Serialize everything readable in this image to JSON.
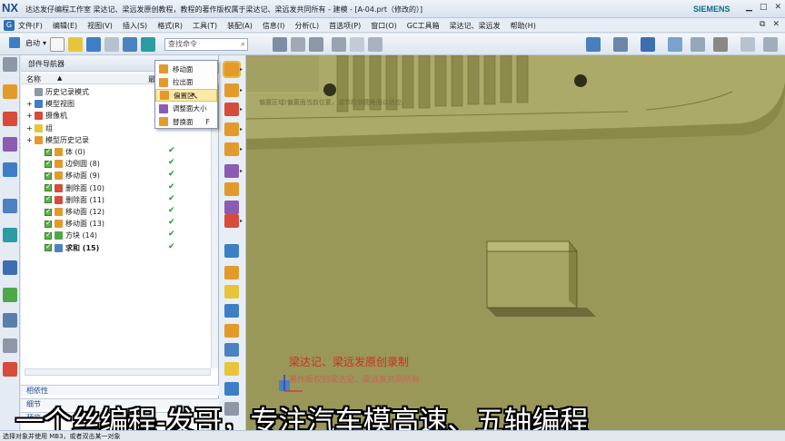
{
  "app": {
    "logo": "NX",
    "title": "达达发仔编程工作室  梁达记、梁远发原创教程，教程的著作版权属于梁达记、梁远发共同所有 - 建模 - [A-04.prt（修改的）]",
    "brand": "SIEMENS"
  },
  "menu": {
    "items": [
      "文件(F)",
      "编辑(E)",
      "视图(V)",
      "插入(S)",
      "格式(R)",
      "工具(T)",
      "装配(A)",
      "信息(I)",
      "分析(L)",
      "首选项(P)",
      "窗口(O)",
      "GC工具箱",
      "梁达记、梁远发",
      "帮助(H)"
    ]
  },
  "toolbar": {
    "start_label": "启动",
    "search_placeholder": "查找命令"
  },
  "navigator": {
    "title": "部件导航器",
    "col_name": "名称",
    "col_latest": "最",
    "nodes": [
      {
        "label": "历史记录模式",
        "level": 1
      },
      {
        "label": "模型视图",
        "level": 1
      },
      {
        "label": "摄像机",
        "level": 1
      },
      {
        "label": "组",
        "level": 1
      },
      {
        "label": "模型历史记录",
        "level": 1
      },
      {
        "label": "体 (0)",
        "level": 2,
        "ok": "✔"
      },
      {
        "label": "边倒圆 (8)",
        "level": 2,
        "ok": "✔"
      },
      {
        "label": "移动面 (9)",
        "level": 2,
        "ok": "✔"
      },
      {
        "label": "删除面 (10)",
        "level": 2,
        "ok": "✔"
      },
      {
        "label": "删除面 (11)",
        "level": 2,
        "ok": "✔"
      },
      {
        "label": "移动面 (12)",
        "level": 2,
        "ok": "✔"
      },
      {
        "label": "移动面 (13)",
        "level": 2,
        "ok": "✔"
      },
      {
        "label": "方块 (14)",
        "level": 2,
        "ok": "✔"
      },
      {
        "label": "求和 (15)",
        "level": 2,
        "ok": "✔"
      }
    ],
    "footer": [
      "相依性",
      "细节",
      "预览"
    ]
  },
  "dropdown": {
    "items": [
      "移动面",
      "拉出面",
      "偏置区",
      "调整面大小",
      "替换面"
    ],
    "shortcut": "F",
    "highlighted": 2
  },
  "viewport": {
    "tooltip": "偏置区域(偏置面当前位置，调节相邻圆角面以适应。",
    "watermark_1": "梁达记、梁远发原创录制",
    "watermark_2": "著作版权归梁达记、梁远发共同所有"
  },
  "subtitle": "一个丝编程-发哥，专注汽车模高速、五轴编程",
  "status": "选择对象并使用 MB3，或者双击某一对象",
  "colors": {
    "model_face": "#a9a766",
    "model_shadow": "#6f6d3c",
    "highlight": "#fbe9a8"
  }
}
